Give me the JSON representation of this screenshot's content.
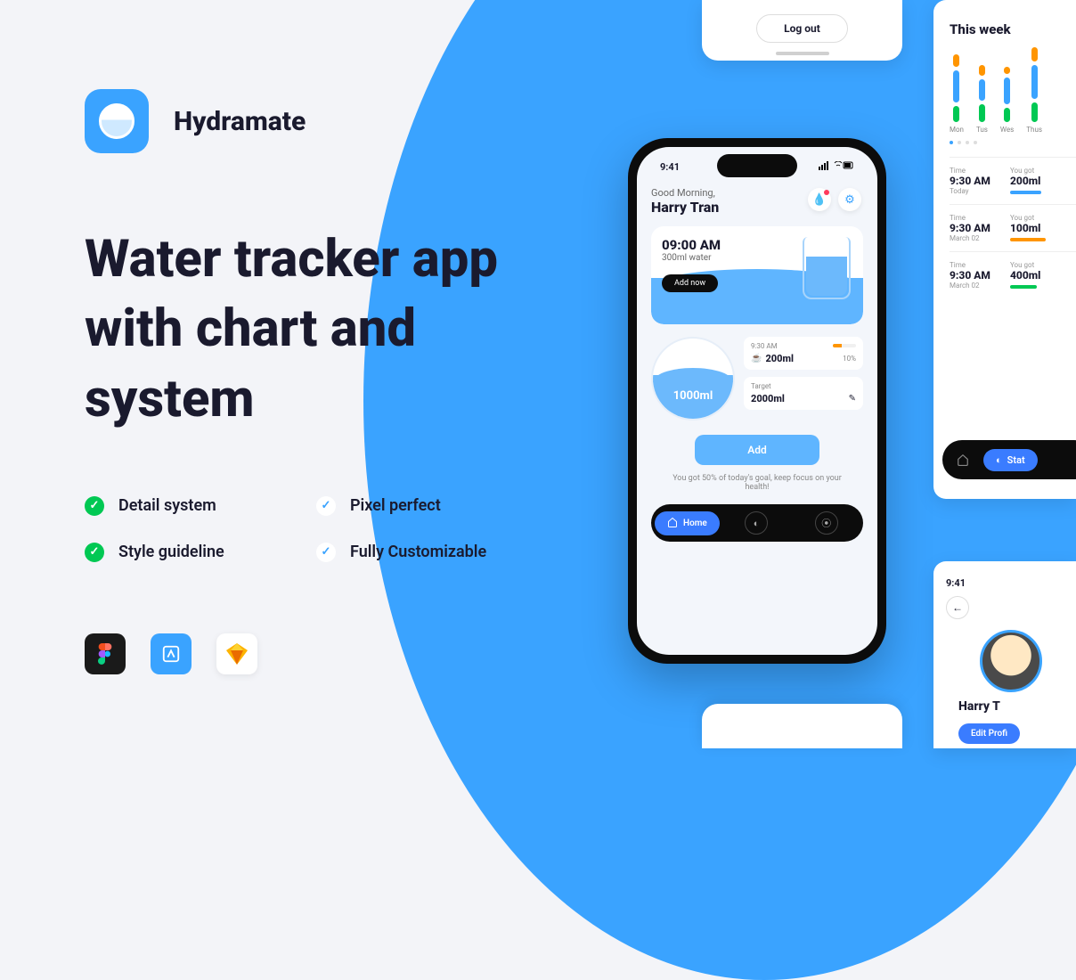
{
  "brand": "Hydramate",
  "headline": "Water tracker app with chart and system",
  "features": [
    {
      "label": "Detail system",
      "color": "green"
    },
    {
      "label": "Pixel perfect",
      "color": "white"
    },
    {
      "label": "Style guideline",
      "color": "green"
    },
    {
      "label": "Fully Customizable",
      "color": "white"
    }
  ],
  "tools": [
    "figma",
    "lunacy",
    "sketch"
  ],
  "logout": {
    "button": "Log out"
  },
  "phone": {
    "status_time": "9:41",
    "greeting": "Good Morning,",
    "user_name": "Harry Tran",
    "reminder": {
      "time": "09:00 AM",
      "amount": "300ml water",
      "cta": "Add now"
    },
    "progress": {
      "current": "1000ml"
    },
    "intake_card": {
      "time": "9:30 AM",
      "amount": "200ml",
      "percent": "10%"
    },
    "target_card": {
      "label": "Target",
      "value": "2000ml"
    },
    "add_button": "Add",
    "tip": "You got 50% of today's goal, keep focus on your health!",
    "nav_home": "Home"
  },
  "stats": {
    "title": "This week",
    "nav_label": "Stat",
    "rows": [
      {
        "time_label": "Time",
        "time": "9:30 AM",
        "sub": "Today",
        "got_label": "You got",
        "amount": "200ml",
        "bar": "b"
      },
      {
        "time_label": "Time",
        "time": "9:30 AM",
        "sub": "March 02",
        "got_label": "You got",
        "amount": "100ml",
        "bar": "o"
      },
      {
        "time_label": "Time",
        "time": "9:30 AM",
        "sub": "March 02",
        "got_label": "You got",
        "amount": "400ml",
        "bar": "g"
      }
    ]
  },
  "profile": {
    "status_time": "9:41",
    "name": "Harry T",
    "edit": "Edit Profi"
  },
  "chart_data": {
    "type": "bar",
    "title": "This week",
    "categories": [
      "Mon",
      "Tus",
      "Wes",
      "Thus"
    ],
    "series": [
      {
        "name": "orange",
        "values": [
          20,
          18,
          10,
          22
        ]
      },
      {
        "name": "blue",
        "values": [
          45,
          30,
          38,
          48
        ]
      },
      {
        "name": "green",
        "values": [
          22,
          25,
          20,
          28
        ]
      }
    ],
    "ylim": [
      0,
      100
    ]
  }
}
